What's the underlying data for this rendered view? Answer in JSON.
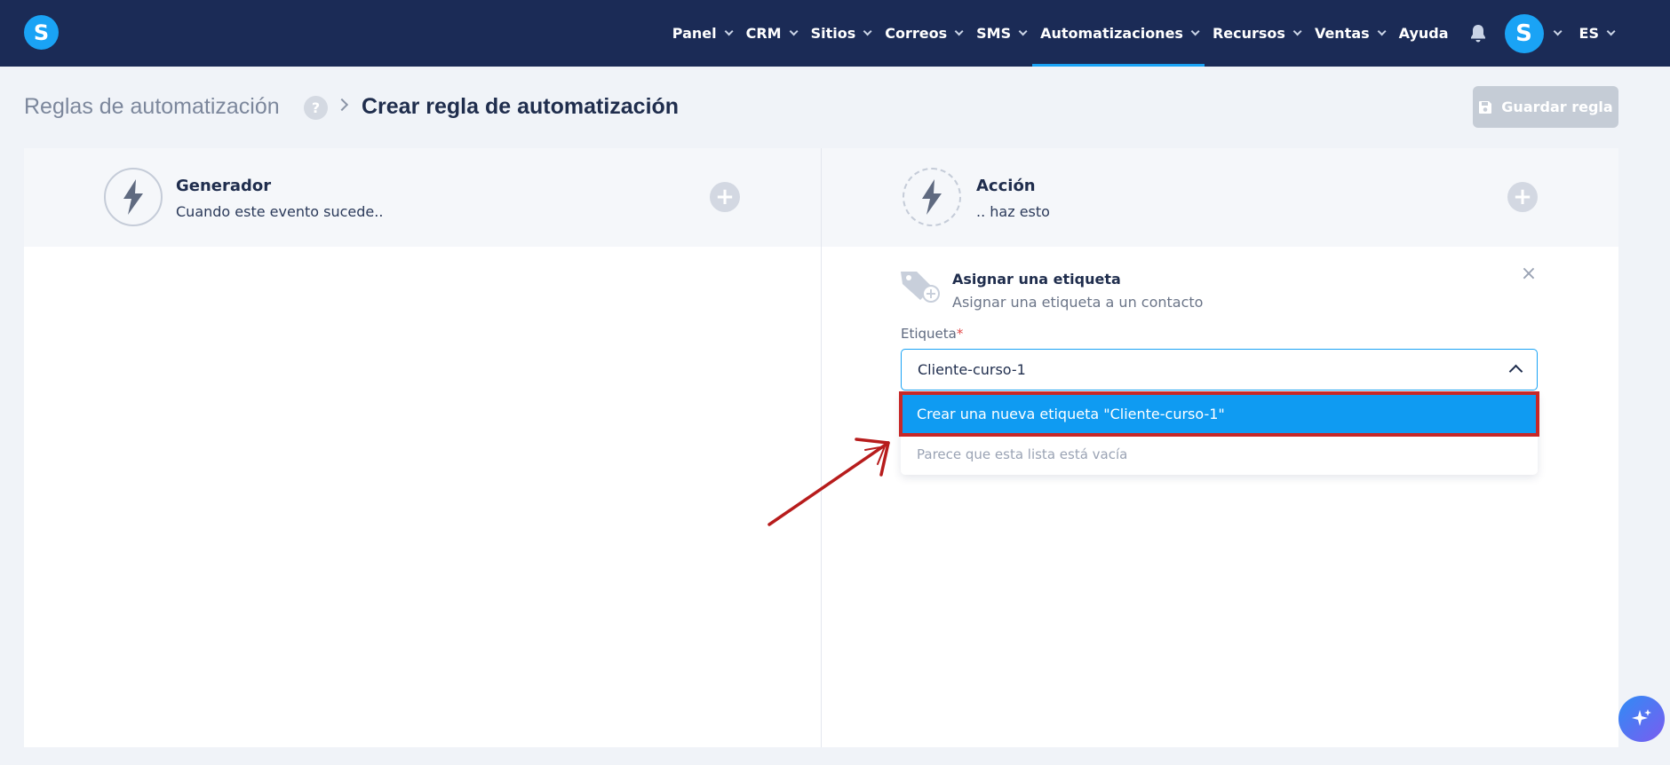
{
  "nav": {
    "logo": "S",
    "items": [
      {
        "label": "Panel"
      },
      {
        "label": "CRM"
      },
      {
        "label": "Sitios"
      },
      {
        "label": "Correos"
      },
      {
        "label": "SMS"
      },
      {
        "label": "Automatizaciones"
      },
      {
        "label": "Recursos"
      },
      {
        "label": "Ventas"
      }
    ],
    "help_label": "Ayuda",
    "avatar": "S",
    "language": "ES",
    "active_item": "Automatizaciones",
    "accent_color": "#1aa3f5",
    "bg_color": "#1b2b56"
  },
  "header": {
    "breadcrumb_parent": "Reglas de automatización",
    "help_icon": "?",
    "breadcrumb_current": "Crear regla de automatización",
    "save_label": "Guardar regla"
  },
  "trigger": {
    "title": "Generador",
    "subtitle": "Cuando este evento sucede.."
  },
  "action": {
    "title": "Acción",
    "subtitle": ".. haz esto",
    "card": {
      "title": "Asignar una etiqueta",
      "subtitle": "Asignar una etiqueta a un contacto",
      "field_label": "Etiqueta",
      "required_mark": "*",
      "value": "Cliente-curso-1",
      "create_option": "Crear una nueva etiqueta \"Cliente-curso-1\"",
      "empty_text": "Parece que esta lista está vacía"
    }
  },
  "icons": {
    "bell": "bell-icon",
    "bolt": "lightning-icon",
    "tag": "tag-plus-icon",
    "close": "close-icon",
    "save": "floppy-disk-icon",
    "fab": "sparkle-icon"
  }
}
